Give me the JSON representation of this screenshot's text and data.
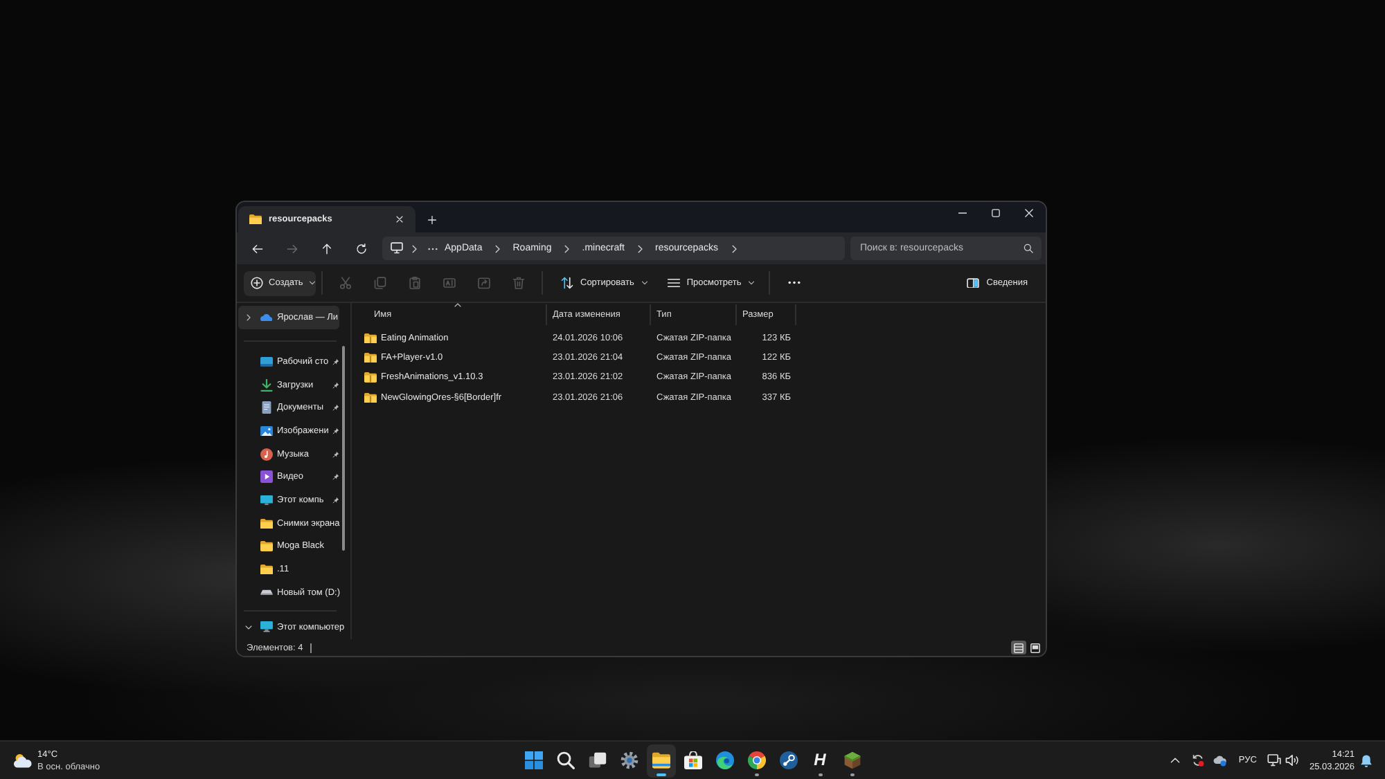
{
  "tabs": [
    {
      "label": "resourcepacks",
      "selected": true
    }
  ],
  "nav": [
    {
      "kind": "back",
      "disabled": false
    },
    {
      "kind": "forward",
      "disabled": true
    },
    {
      "kind": "up",
      "disabled": false
    },
    {
      "kind": "refresh",
      "disabled": false
    }
  ],
  "address": {
    "crumbs": [
      "AppData",
      "Roaming",
      ".minecraft",
      "resourcepacks"
    ]
  },
  "search": {
    "placeholder": "Поиск в: resourcepacks"
  },
  "toolbar": {
    "new_label": "Создать",
    "actions": [
      {
        "kind": "cut",
        "disabled": true
      },
      {
        "kind": "copy",
        "disabled": true
      },
      {
        "kind": "paste",
        "disabled": true
      },
      {
        "kind": "rename",
        "disabled": true
      },
      {
        "kind": "share",
        "disabled": true
      },
      {
        "kind": "delete",
        "disabled": true
      }
    ],
    "sort_label": "Сортировать",
    "view_label": "Просмотреть",
    "details_label": "Сведения"
  },
  "sidebar": {
    "home": {
      "label": "Ярослав — Ли",
      "expanded": false,
      "selected": true
    },
    "items": [
      {
        "label": "Рабочий сто",
        "kind": "desktop",
        "pinned": true,
        "selected": false
      },
      {
        "label": "Загрузки",
        "kind": "downloads",
        "pinned": true,
        "selected": false
      },
      {
        "label": "Документы",
        "kind": "documents",
        "pinned": true,
        "selected": false
      },
      {
        "label": "Изображени",
        "kind": "pictures",
        "pinned": true,
        "selected": false
      },
      {
        "label": "Музыка",
        "kind": "music",
        "pinned": true,
        "selected": false
      },
      {
        "label": "Видео",
        "kind": "video",
        "pinned": true,
        "selected": false
      },
      {
        "label": "Этот компь",
        "kind": "pc",
        "pinned": true,
        "selected": false
      },
      {
        "label": "Снимки экрана",
        "kind": "folder",
        "pinned": false,
        "selected": false
      },
      {
        "label": "Moga Black",
        "kind": "folder",
        "pinned": false,
        "selected": false
      },
      {
        "label": ".11",
        "kind": "folder",
        "pinned": false,
        "selected": false
      },
      {
        "label": "Новый том (D:)",
        "kind": "drive",
        "pinned": false,
        "selected": false
      }
    ],
    "this_pc": {
      "label": "Этот компьютер",
      "expanded": true,
      "selected": false
    }
  },
  "table": {
    "columns": [
      {
        "label": "Имя",
        "sorted": true
      },
      {
        "label": "Дата изменения",
        "sorted": false
      },
      {
        "label": "Тип",
        "sorted": false
      },
      {
        "label": "Размер",
        "sorted": false
      }
    ],
    "rows": [
      {
        "name": "Eating Animation",
        "date": "24.01.2026 10:06",
        "type": "Сжатая ZIP-папка",
        "size": "123 КБ"
      },
      {
        "name": "FA+Player-v1.0",
        "date": "23.01.2026 21:04",
        "type": "Сжатая ZIP-папка",
        "size": "122 КБ"
      },
      {
        "name": "FreshAnimations_v1.10.3",
        "date": "23.01.2026 21:02",
        "type": "Сжатая ZIP-папка",
        "size": "836 КБ"
      },
      {
        "name": "NewGlowingOres-§6[Border]fr",
        "date": "23.01.2026 21:06",
        "type": "Сжатая ZIP-папка",
        "size": "337 КБ"
      }
    ]
  },
  "status_bar": {
    "text": "Элементов: 4",
    "views": [
      {
        "kind": "details",
        "selected": true
      },
      {
        "kind": "tiles",
        "selected": false
      }
    ]
  },
  "taskbar": {
    "weather": {
      "temperature": "14°C",
      "condition": "В осн. облачно"
    },
    "apps": [
      {
        "kind": "start",
        "selected": false,
        "running": false
      },
      {
        "kind": "search",
        "selected": false,
        "running": false
      },
      {
        "kind": "task_view",
        "selected": false,
        "running": false
      },
      {
        "kind": "settings",
        "selected": false,
        "running": false
      },
      {
        "kind": "explorer",
        "selected": true,
        "running": true
      },
      {
        "kind": "store",
        "selected": false,
        "running": false
      },
      {
        "kind": "edge",
        "selected": false,
        "running": false
      },
      {
        "kind": "chrome",
        "selected": false,
        "running": true
      },
      {
        "kind": "steam",
        "selected": false,
        "running": false
      },
      {
        "kind": "letter",
        "glyph": "H",
        "selected": false,
        "running": true
      },
      {
        "kind": "minecraft",
        "selected": false,
        "running": true
      }
    ],
    "tray": {
      "language": "РУС",
      "time": "14:21",
      "date": "25.03.2026"
    }
  }
}
